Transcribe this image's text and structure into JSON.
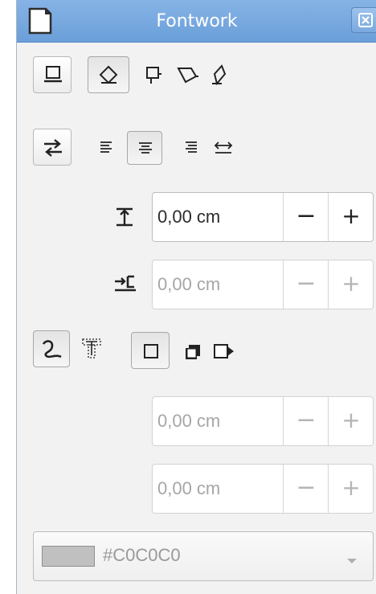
{
  "window": {
    "title": "Fontwork",
    "icons": {
      "document": "document-icon",
      "close": "close-icon"
    }
  },
  "alignment_row": {
    "icons": [
      "fontwork-off-icon",
      "rotate-icon",
      "upright-icon",
      "slant-horizontal-icon",
      "slant-vertical-icon"
    ]
  },
  "orientation_row": {
    "icons": [
      "orientation-icon",
      "align-left-icon",
      "align-center-icon",
      "align-right-icon",
      "autosize-text-icon"
    ]
  },
  "distance": {
    "value": "0,00 cm",
    "minus": "−",
    "plus": "+"
  },
  "indent": {
    "value": "0,00 cm",
    "minus": "−",
    "plus": "+"
  },
  "contour_row": {
    "icons": [
      "contour-icon",
      "text-frame-icon",
      "shadow-off-icon",
      "shadow-vertical-icon",
      "shadow-slant-icon"
    ]
  },
  "shadow_x": {
    "value": "0,00 cm",
    "minus": "−",
    "plus": "+"
  },
  "shadow_y": {
    "value": "0,00 cm",
    "minus": "−",
    "plus": "+"
  },
  "shadow_color": {
    "label": "#C0C0C0",
    "swatch": "#c0c0c0"
  }
}
